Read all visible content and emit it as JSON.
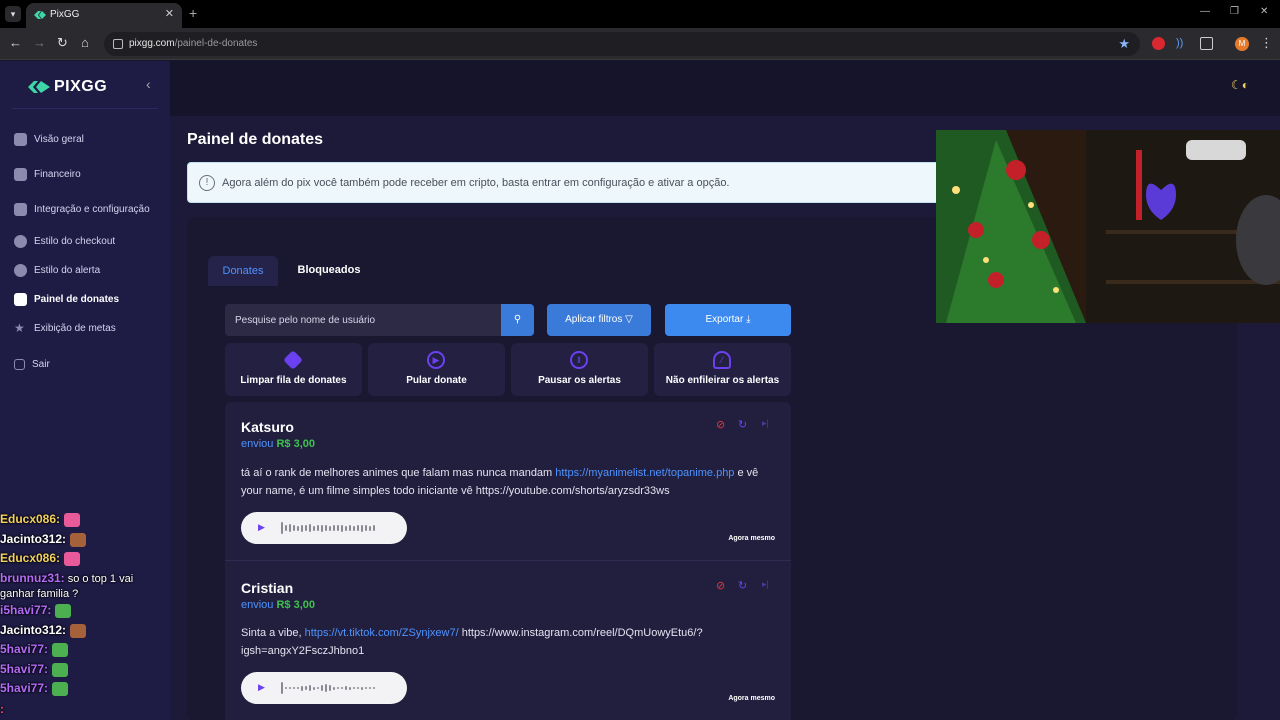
{
  "browser": {
    "tab_title": "PixGG",
    "url_host": "pixgg.com",
    "url_path": "/painel-de-donates",
    "avatar_initial": "M"
  },
  "sidebar": {
    "logo_text": "PIXGG",
    "items": [
      {
        "label": "Visão geral",
        "icon": "home-icon"
      },
      {
        "label": "Financeiro",
        "icon": "wallet-icon"
      },
      {
        "label": "Integração e configuração",
        "icon": "sliders-icon"
      },
      {
        "label": "Estilo do checkout",
        "icon": "palette-icon"
      },
      {
        "label": "Estilo do alerta",
        "icon": "palette-icon"
      },
      {
        "label": "Painel de donates",
        "icon": "donate-hand-icon",
        "active": true
      },
      {
        "label": "Exibição de metas",
        "icon": "star-icon"
      },
      {
        "label": "Sair",
        "icon": "logout-icon"
      }
    ]
  },
  "page": {
    "title": "Painel de donates",
    "info_banner": "Agora além do pix você também pode receber em cripto, basta entrar em configuração e ativar a opção.",
    "tabs": [
      "Donates",
      "Bloqueados"
    ],
    "search_placeholder": "Pesquise pelo nome de usuário",
    "filters_button": "Aplicar filtros",
    "export_button": "Exportar",
    "actions": [
      "Limpar fila de donates",
      "Pular donate",
      "Pausar os alertas",
      "Não enfileirar os alertas"
    ]
  },
  "donates": [
    {
      "name": "Katsuro",
      "sent_label": "enviou",
      "amount": "R$ 3,00",
      "msg_before": "tá aí o rank de melhores animes que falam mas nunca mandam ",
      "msg_link": "https://myanimelist.net/topanime.php",
      "msg_after": " e vê your name, é um filme simples todo iniciante vê https://youtube.com/shorts/aryzsdr33ws",
      "time": "Agora mesmo"
    },
    {
      "name": "Cristian",
      "sent_label": "enviou",
      "amount": "R$ 3,00",
      "msg_before": "Sinta a vibe, ",
      "msg_link": "https://vt.tiktok.com/ZSynjxew7/",
      "msg_after": " https://www.instagram.com/reel/DQmUowyEtu6/?igsh=angxY2FsczJhbno1",
      "time": "Agora mesmo"
    }
  ],
  "chat": [
    {
      "user": "Educx086:",
      "msg": "",
      "color": "#f2d25e"
    },
    {
      "user": "Jacinto312:",
      "msg": "",
      "color": "#ffffff"
    },
    {
      "user": "Educx086:",
      "msg": "",
      "color": "#f2d25e"
    },
    {
      "user": "brunnuz31:",
      "msg": "so o top 1 vai",
      "color": "#b26cf5"
    },
    {
      "user": "",
      "msg": "ganhar familia ?",
      "color": "#ffffff"
    },
    {
      "user": "i5havi77:",
      "msg": "",
      "color": "#b26cf5"
    },
    {
      "user": "Jacinto312:",
      "msg": "",
      "color": "#ffffff"
    },
    {
      "user": "5havi77:",
      "msg": "",
      "color": "#b26cf5"
    },
    {
      "user": "5havi77:",
      "msg": "",
      "color": "#b26cf5"
    },
    {
      "user": "5havi77:",
      "msg": "",
      "color": "#b26cf5"
    },
    {
      "user": ":",
      "msg": "",
      "color": "#ff5050"
    }
  ],
  "colors": {
    "accent": "#3a7ad9",
    "amount": "#3ec24e",
    "sidebar": "#1e1b45"
  }
}
